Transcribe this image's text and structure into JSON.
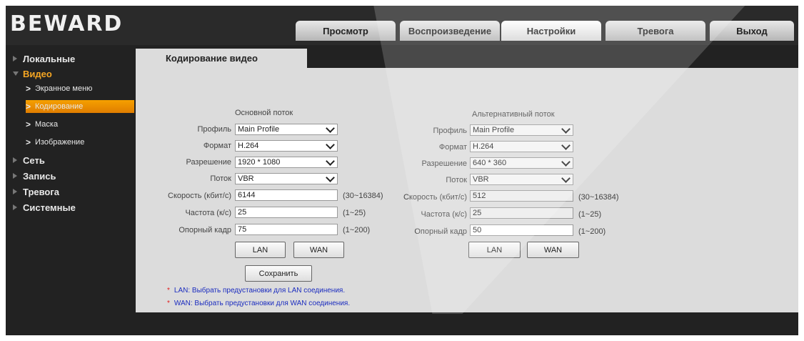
{
  "brand": {
    "logo_text": "BEWARD"
  },
  "header": {
    "tabs": [
      {
        "label": "Просмотр",
        "active": false
      },
      {
        "label": "Воспроизведение",
        "active": false
      },
      {
        "label": "Настройки",
        "active": true
      },
      {
        "label": "Тревога",
        "active": false
      },
      {
        "label": "Выход",
        "active": false
      }
    ]
  },
  "sidebar": {
    "items": [
      {
        "label": "Локальные",
        "open": false
      },
      {
        "label": "Видео",
        "open": true
      },
      {
        "label": "Сеть",
        "open": false
      },
      {
        "label": "Запись",
        "open": false
      },
      {
        "label": "Тревога",
        "open": false
      },
      {
        "label": "Системные",
        "open": false
      }
    ],
    "video_sub": [
      {
        "label": "Экранное меню",
        "selected": false
      },
      {
        "label": "Кодирование",
        "selected": true
      },
      {
        "label": "Маска",
        "selected": false
      },
      {
        "label": "Изображение",
        "selected": false
      }
    ]
  },
  "content": {
    "tab_title": "Кодирование видео",
    "labels": {
      "profile": "Профиль",
      "format": "Формат",
      "resolution": "Разрешение",
      "stream": "Поток",
      "bitrate": "Скорость (кбит/с)",
      "fps": "Частота (к/с)",
      "iframe": "Опорный кадр"
    },
    "main": {
      "title": "Основной поток",
      "profile": "Main Profile",
      "format": "H.264",
      "resolution": "1920 * 1080",
      "stream": "VBR",
      "bitrate": "6144",
      "bitrate_range": "(30~16384)",
      "fps": "25",
      "fps_range": "(1~25)",
      "iframe": "75",
      "iframe_range": "(1~200)",
      "lan_button": "LAN",
      "wan_button": "WAN"
    },
    "alt": {
      "title": "Альтернативный поток",
      "profile": "Main Profile",
      "format": "H.264",
      "resolution": "640 * 360",
      "stream": "VBR",
      "bitrate": "512",
      "bitrate_range": "(30~16384)",
      "fps": "25",
      "fps_range": "(1~25)",
      "iframe": "50",
      "iframe_range": "(1~200)",
      "lan_button": "LAN",
      "wan_button": "WAN"
    },
    "save_button": "Сохранить",
    "notes": [
      "LAN: Выбрать предустановки для LAN соединения.",
      "WAN: Выбрать предустановки для WAN соединения."
    ],
    "note_bullet": "*"
  },
  "colors": {
    "accent": "#f5a000",
    "note_text": "#1b2cbf",
    "note_bullet": "#e21b1b",
    "panel": "#dcdcdc",
    "background": "#222222"
  }
}
